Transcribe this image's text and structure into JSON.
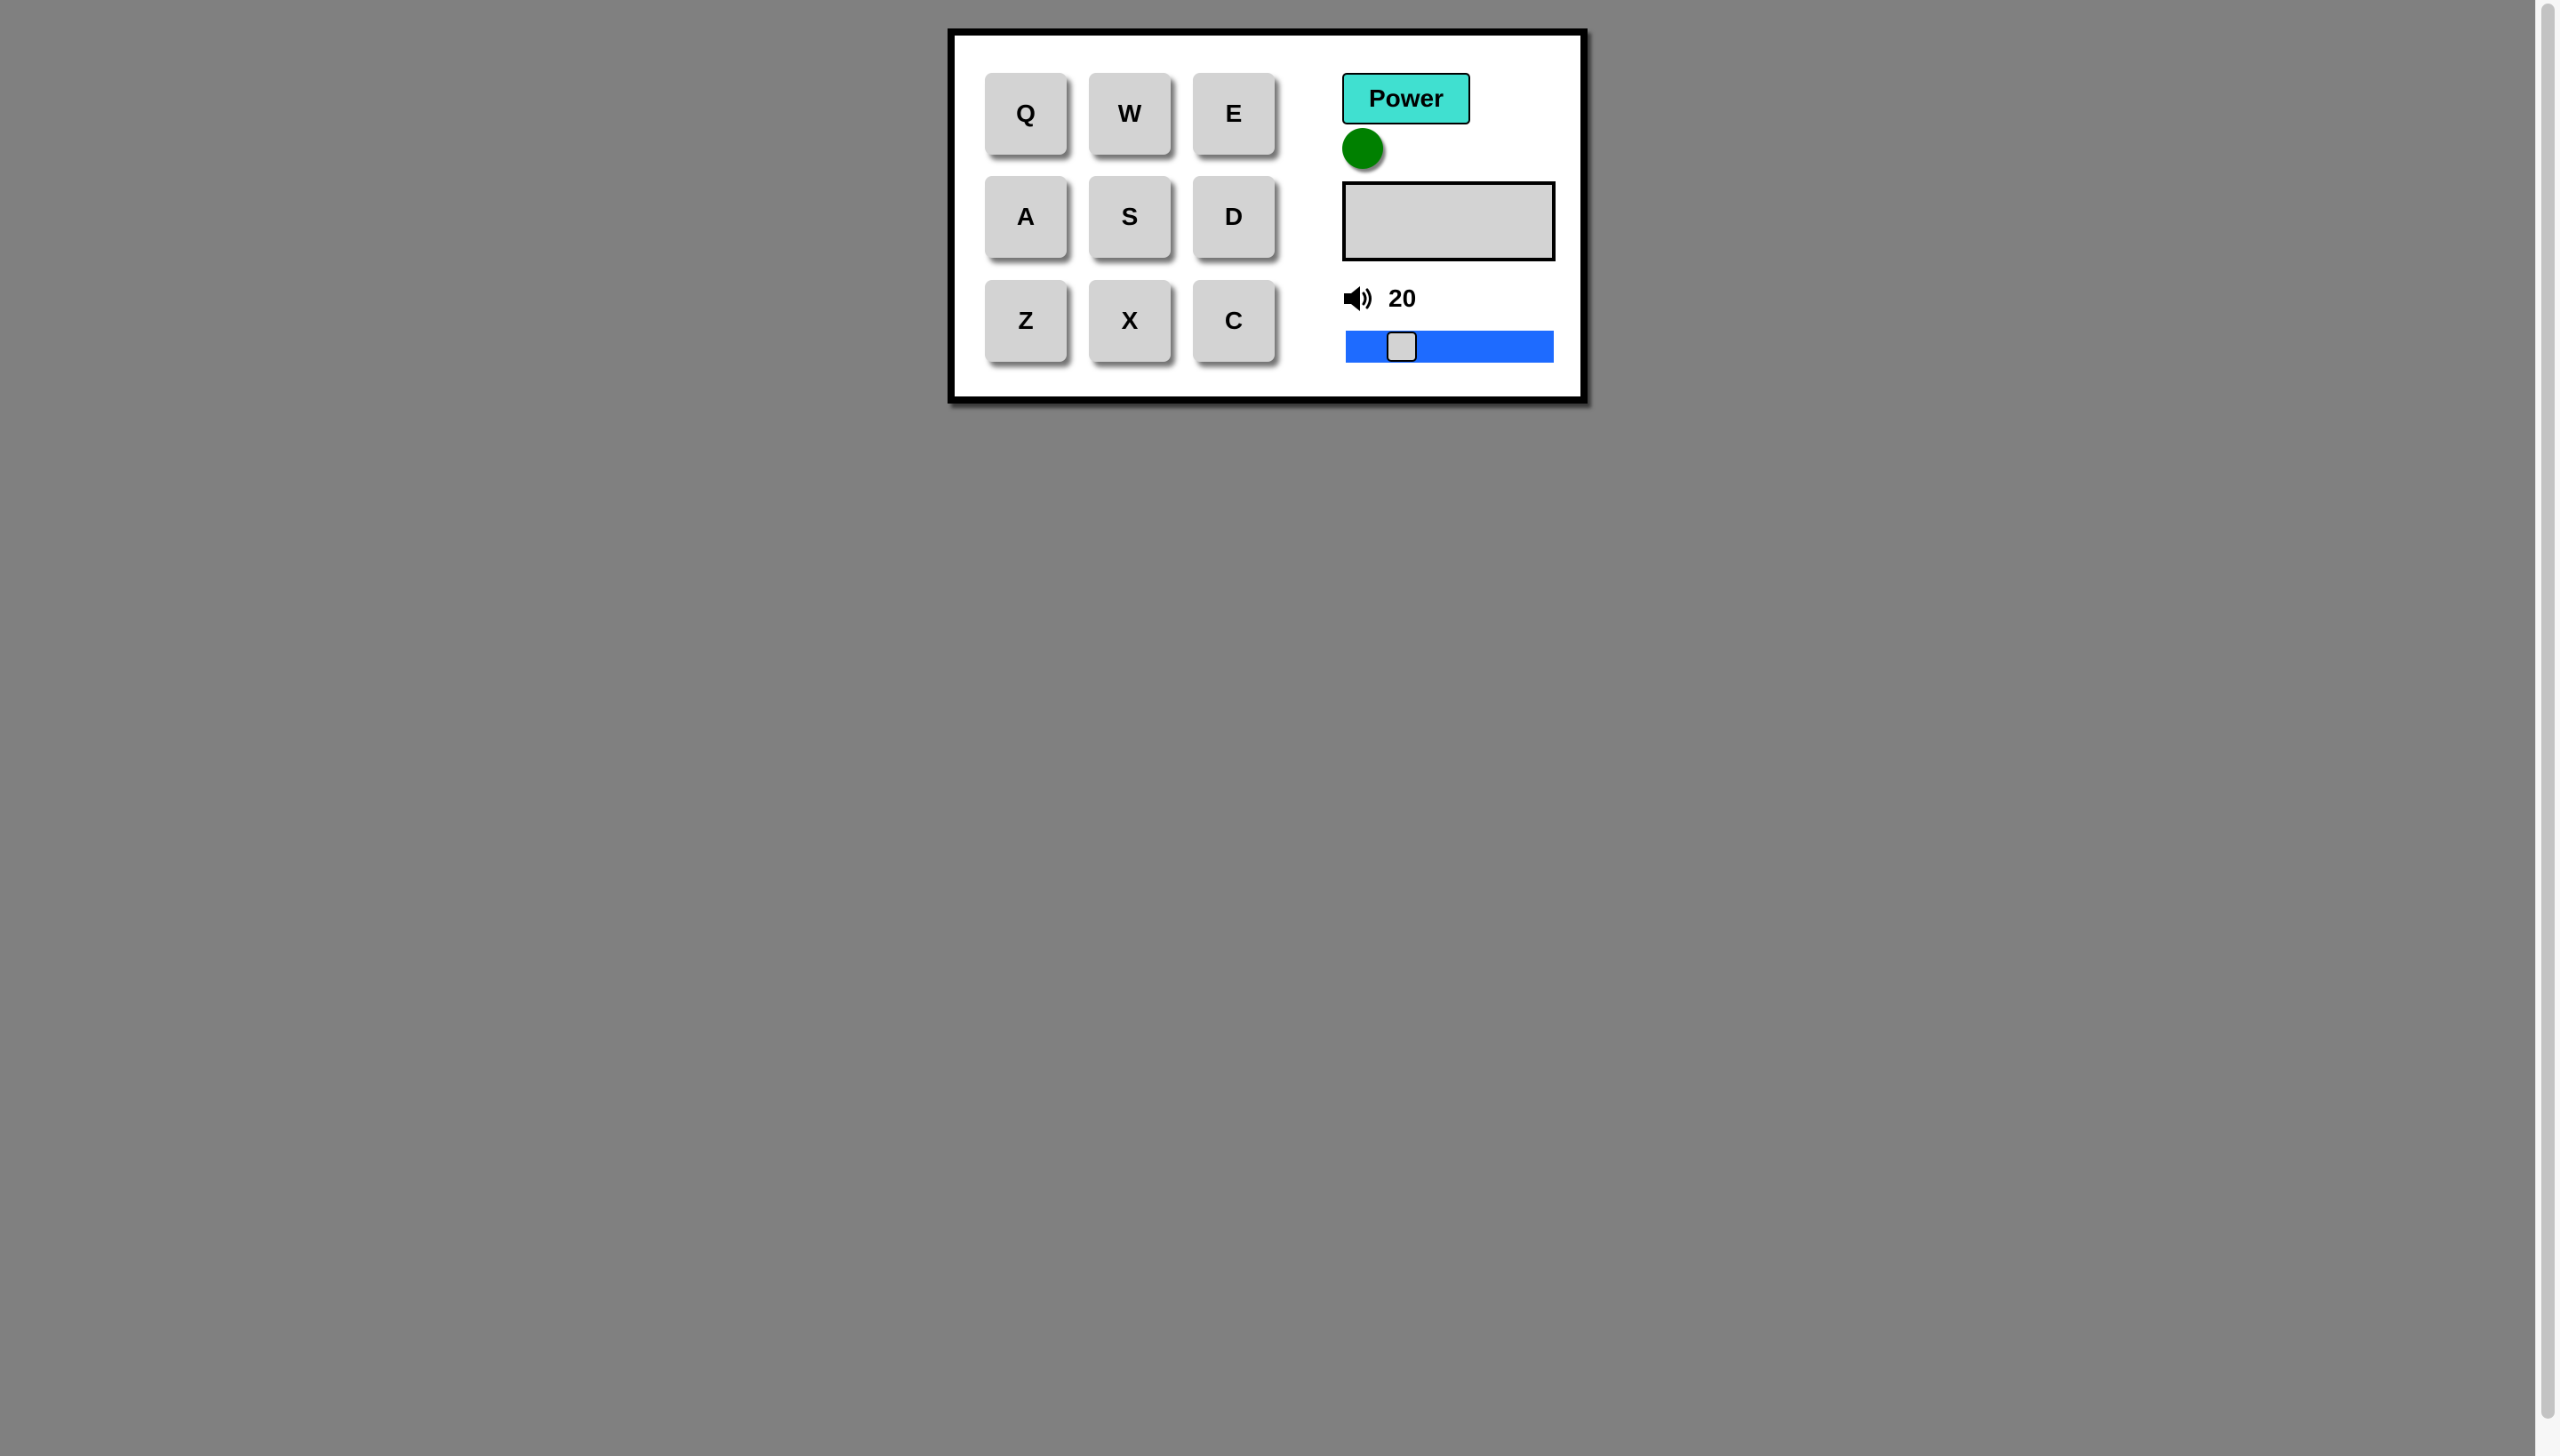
{
  "pads": [
    {
      "key": "Q"
    },
    {
      "key": "W"
    },
    {
      "key": "E"
    },
    {
      "key": "A"
    },
    {
      "key": "S"
    },
    {
      "key": "D"
    },
    {
      "key": "Z"
    },
    {
      "key": "X"
    },
    {
      "key": "C"
    }
  ],
  "controls": {
    "power_label": "Power",
    "power_on": true,
    "power_indicator_color": "#008000",
    "power_button_color": "#40e0d0",
    "display_text": "",
    "volume_icon": "speaker-volume-icon",
    "volume_value": "20",
    "volume_fraction": 0.2,
    "slider_color": "#1e6bff"
  },
  "page": {
    "background_color": "#808080"
  }
}
